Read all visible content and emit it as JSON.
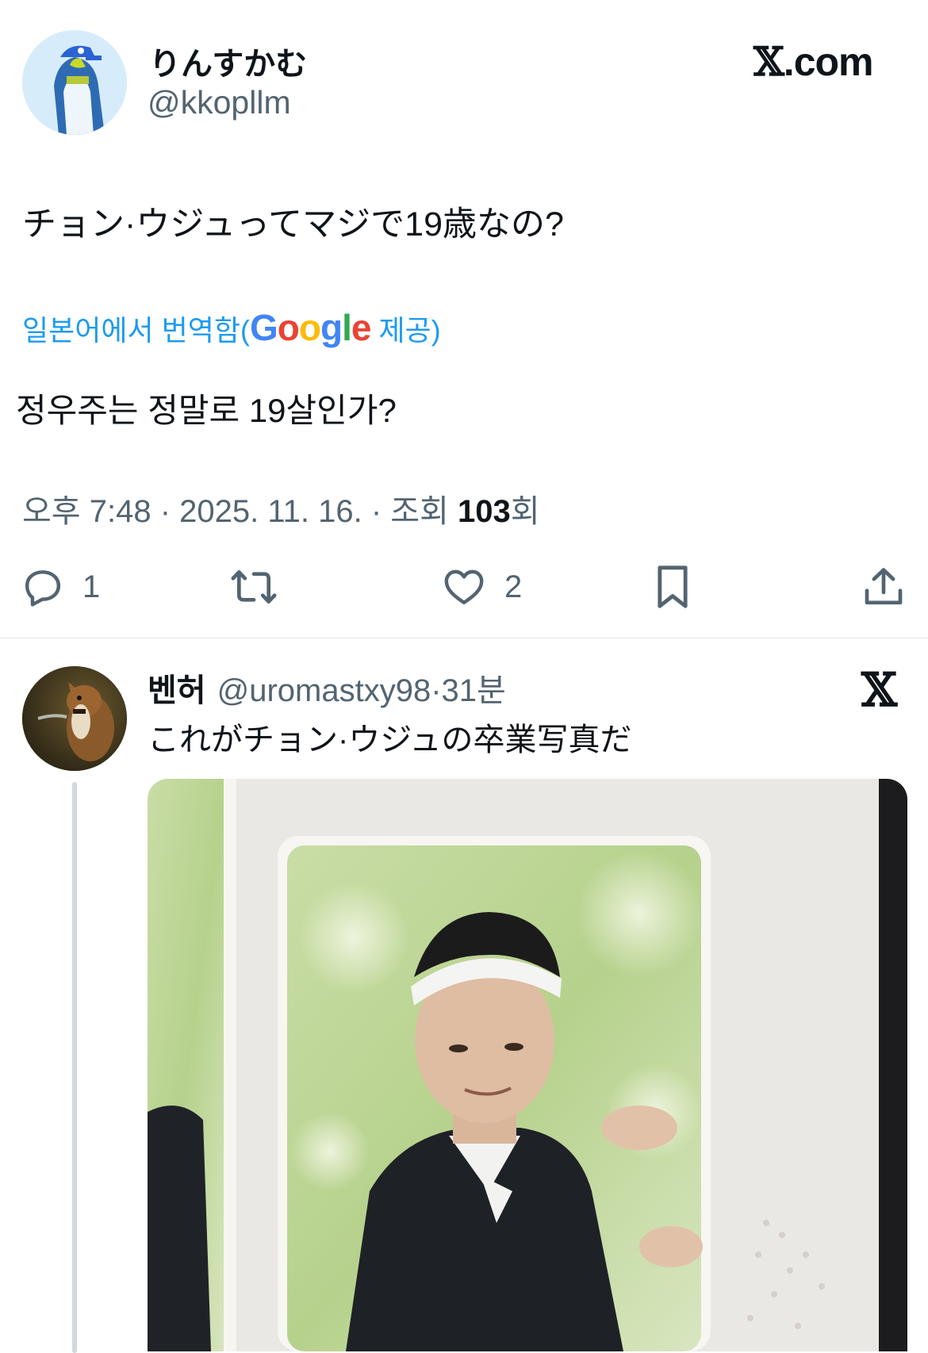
{
  "header": {
    "display_name": "りんすかむ",
    "handle": "@kkopllm",
    "brand_x": "𝕏",
    "brand_domain": ".com"
  },
  "tweet": {
    "text": "チョン·ウジュってマジで19歳なの?",
    "translation_prefix": "일본어에서 번역함(",
    "translation_provider": "Google",
    "translation_suffix": " 제공)",
    "translated_text": "정우주는 정말로 19살인가?",
    "time": "오후 7:48",
    "separator": " · ",
    "date": "2025. 11. 16.",
    "views_label": "조회 ",
    "views_count": "103",
    "views_suffix": "회"
  },
  "actions": {
    "reply_count": "1",
    "like_count": "2"
  },
  "reply": {
    "display_name": "벤허",
    "handle": "@uromastxy98",
    "time_sep": "·",
    "time": "31분",
    "text": "これがチョン·ウジュの卒業写真だ",
    "x_mark": "𝕏"
  },
  "colors": {
    "accent": "#1d9bf0",
    "text_primary": "#0f1419",
    "text_secondary": "#536471",
    "divider": "#e1e6ea",
    "google_blue": "#4285f4",
    "google_red": "#ea4335",
    "google_yellow": "#fbbc05",
    "google_green": "#34a853"
  },
  "icons": {
    "reply": "speech-bubble-icon",
    "repost": "repost-arrows-icon",
    "like": "heart-icon",
    "bookmark": "bookmark-icon",
    "share": "share-upload-icon"
  }
}
